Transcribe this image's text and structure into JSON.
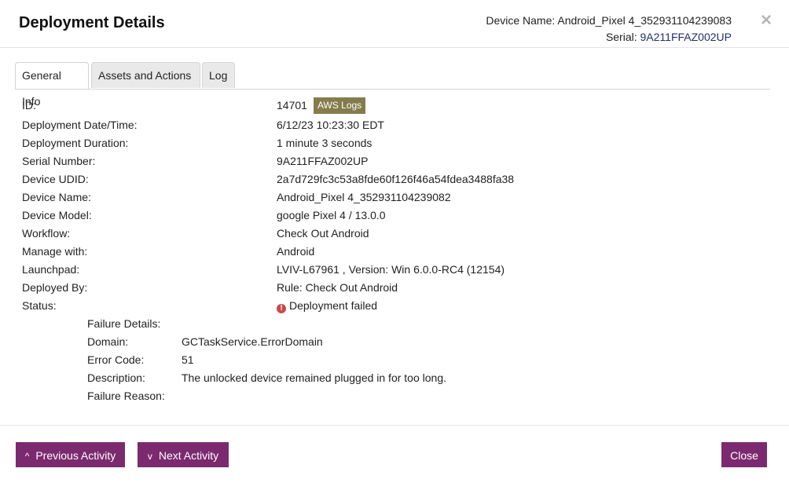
{
  "header": {
    "title": "Deployment Details",
    "device_name_label": "Device Name:",
    "device_name_value": "Android_Pixel 4_352931104239083",
    "serial_label": "Serial:",
    "serial_value": "9A211FFAZ002UP",
    "close_icon": "×"
  },
  "tabs": [
    {
      "label": "General Info",
      "active": true
    },
    {
      "label": "Assets and Actions",
      "active": false
    },
    {
      "label": "Log",
      "active": false
    }
  ],
  "details": {
    "id": {
      "label": "ID:",
      "value": "14701"
    },
    "aws_logs_label": "AWS Logs",
    "date": {
      "label": "Deployment Date/Time:",
      "value": "6/12/23 10:23:30 EDT"
    },
    "duration": {
      "label": "Deployment Duration:",
      "value": "1 minute 3 seconds"
    },
    "serial": {
      "label": "Serial Number:",
      "value": "9A211FFAZ002UP"
    },
    "udid": {
      "label": "Device UDID:",
      "value": "2a7d729fc3c53a8fde60f126f46a54fdea3488fa38"
    },
    "device_name": {
      "label": "Device Name:",
      "value": "Android_Pixel 4_352931104239082"
    },
    "device_model": {
      "label": "Device Model:",
      "value": "google Pixel 4 / 13.0.0"
    },
    "workflow": {
      "label": "Workflow:",
      "value": "Check Out Android"
    },
    "manage_with": {
      "label": "Manage with:",
      "value": "Android"
    },
    "launchpad": {
      "label": "Launchpad:",
      "value": "LVIV-L67961 , Version: Win 6.0.0-RC4 (12154)"
    },
    "deployed_by": {
      "label": "Deployed By:",
      "value": "Rule: Check Out Android"
    },
    "status": {
      "label": "Status:",
      "value": "Deployment failed",
      "icon": "!"
    }
  },
  "failure": {
    "title": "Failure Details:",
    "domain": {
      "label": "Domain:",
      "value": "GCTaskService.ErrorDomain"
    },
    "error_code": {
      "label": "Error Code:",
      "value": "51"
    },
    "description": {
      "label": "Description:",
      "value": "The unlocked device remained plugged in for too long."
    },
    "reason": {
      "label": "Failure Reason:",
      "value": ""
    }
  },
  "footer": {
    "prev_label": "Previous Activity",
    "prev_icon": "^",
    "next_label": "Next Activity",
    "next_icon": "v",
    "close_label": "Close"
  },
  "colors": {
    "button_bg": "#7b2a6f",
    "aws_button_bg": "#857c4c",
    "error_icon": "#c94a4a",
    "serial_link": "#1f2f6b"
  }
}
